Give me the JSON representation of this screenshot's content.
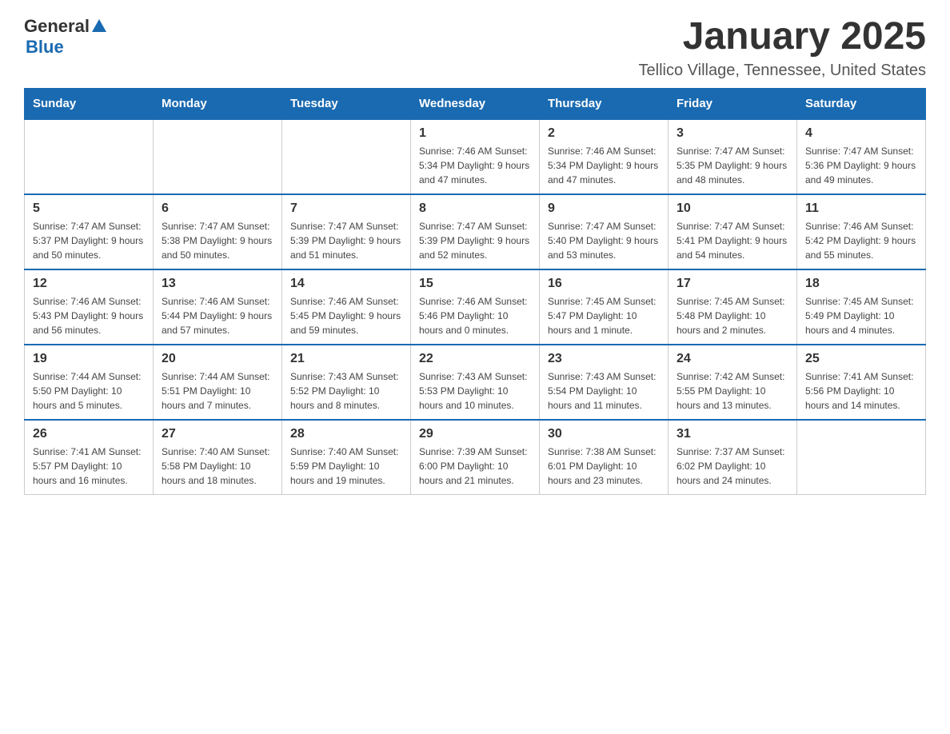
{
  "header": {
    "logo": {
      "general": "General",
      "blue": "Blue"
    },
    "title": "January 2025",
    "location": "Tellico Village, Tennessee, United States"
  },
  "calendar": {
    "days_of_week": [
      "Sunday",
      "Monday",
      "Tuesday",
      "Wednesday",
      "Thursday",
      "Friday",
      "Saturday"
    ],
    "weeks": [
      {
        "days": [
          {
            "number": "",
            "info": ""
          },
          {
            "number": "",
            "info": ""
          },
          {
            "number": "",
            "info": ""
          },
          {
            "number": "1",
            "info": "Sunrise: 7:46 AM\nSunset: 5:34 PM\nDaylight: 9 hours and 47 minutes."
          },
          {
            "number": "2",
            "info": "Sunrise: 7:46 AM\nSunset: 5:34 PM\nDaylight: 9 hours and 47 minutes."
          },
          {
            "number": "3",
            "info": "Sunrise: 7:47 AM\nSunset: 5:35 PM\nDaylight: 9 hours and 48 minutes."
          },
          {
            "number": "4",
            "info": "Sunrise: 7:47 AM\nSunset: 5:36 PM\nDaylight: 9 hours and 49 minutes."
          }
        ]
      },
      {
        "days": [
          {
            "number": "5",
            "info": "Sunrise: 7:47 AM\nSunset: 5:37 PM\nDaylight: 9 hours and 50 minutes."
          },
          {
            "number": "6",
            "info": "Sunrise: 7:47 AM\nSunset: 5:38 PM\nDaylight: 9 hours and 50 minutes."
          },
          {
            "number": "7",
            "info": "Sunrise: 7:47 AM\nSunset: 5:39 PM\nDaylight: 9 hours and 51 minutes."
          },
          {
            "number": "8",
            "info": "Sunrise: 7:47 AM\nSunset: 5:39 PM\nDaylight: 9 hours and 52 minutes."
          },
          {
            "number": "9",
            "info": "Sunrise: 7:47 AM\nSunset: 5:40 PM\nDaylight: 9 hours and 53 minutes."
          },
          {
            "number": "10",
            "info": "Sunrise: 7:47 AM\nSunset: 5:41 PM\nDaylight: 9 hours and 54 minutes."
          },
          {
            "number": "11",
            "info": "Sunrise: 7:46 AM\nSunset: 5:42 PM\nDaylight: 9 hours and 55 minutes."
          }
        ]
      },
      {
        "days": [
          {
            "number": "12",
            "info": "Sunrise: 7:46 AM\nSunset: 5:43 PM\nDaylight: 9 hours and 56 minutes."
          },
          {
            "number": "13",
            "info": "Sunrise: 7:46 AM\nSunset: 5:44 PM\nDaylight: 9 hours and 57 minutes."
          },
          {
            "number": "14",
            "info": "Sunrise: 7:46 AM\nSunset: 5:45 PM\nDaylight: 9 hours and 59 minutes."
          },
          {
            "number": "15",
            "info": "Sunrise: 7:46 AM\nSunset: 5:46 PM\nDaylight: 10 hours and 0 minutes."
          },
          {
            "number": "16",
            "info": "Sunrise: 7:45 AM\nSunset: 5:47 PM\nDaylight: 10 hours and 1 minute."
          },
          {
            "number": "17",
            "info": "Sunrise: 7:45 AM\nSunset: 5:48 PM\nDaylight: 10 hours and 2 minutes."
          },
          {
            "number": "18",
            "info": "Sunrise: 7:45 AM\nSunset: 5:49 PM\nDaylight: 10 hours and 4 minutes."
          }
        ]
      },
      {
        "days": [
          {
            "number": "19",
            "info": "Sunrise: 7:44 AM\nSunset: 5:50 PM\nDaylight: 10 hours and 5 minutes."
          },
          {
            "number": "20",
            "info": "Sunrise: 7:44 AM\nSunset: 5:51 PM\nDaylight: 10 hours and 7 minutes."
          },
          {
            "number": "21",
            "info": "Sunrise: 7:43 AM\nSunset: 5:52 PM\nDaylight: 10 hours and 8 minutes."
          },
          {
            "number": "22",
            "info": "Sunrise: 7:43 AM\nSunset: 5:53 PM\nDaylight: 10 hours and 10 minutes."
          },
          {
            "number": "23",
            "info": "Sunrise: 7:43 AM\nSunset: 5:54 PM\nDaylight: 10 hours and 11 minutes."
          },
          {
            "number": "24",
            "info": "Sunrise: 7:42 AM\nSunset: 5:55 PM\nDaylight: 10 hours and 13 minutes."
          },
          {
            "number": "25",
            "info": "Sunrise: 7:41 AM\nSunset: 5:56 PM\nDaylight: 10 hours and 14 minutes."
          }
        ]
      },
      {
        "days": [
          {
            "number": "26",
            "info": "Sunrise: 7:41 AM\nSunset: 5:57 PM\nDaylight: 10 hours and 16 minutes."
          },
          {
            "number": "27",
            "info": "Sunrise: 7:40 AM\nSunset: 5:58 PM\nDaylight: 10 hours and 18 minutes."
          },
          {
            "number": "28",
            "info": "Sunrise: 7:40 AM\nSunset: 5:59 PM\nDaylight: 10 hours and 19 minutes."
          },
          {
            "number": "29",
            "info": "Sunrise: 7:39 AM\nSunset: 6:00 PM\nDaylight: 10 hours and 21 minutes."
          },
          {
            "number": "30",
            "info": "Sunrise: 7:38 AM\nSunset: 6:01 PM\nDaylight: 10 hours and 23 minutes."
          },
          {
            "number": "31",
            "info": "Sunrise: 7:37 AM\nSunset: 6:02 PM\nDaylight: 10 hours and 24 minutes."
          },
          {
            "number": "",
            "info": ""
          }
        ]
      }
    ]
  }
}
